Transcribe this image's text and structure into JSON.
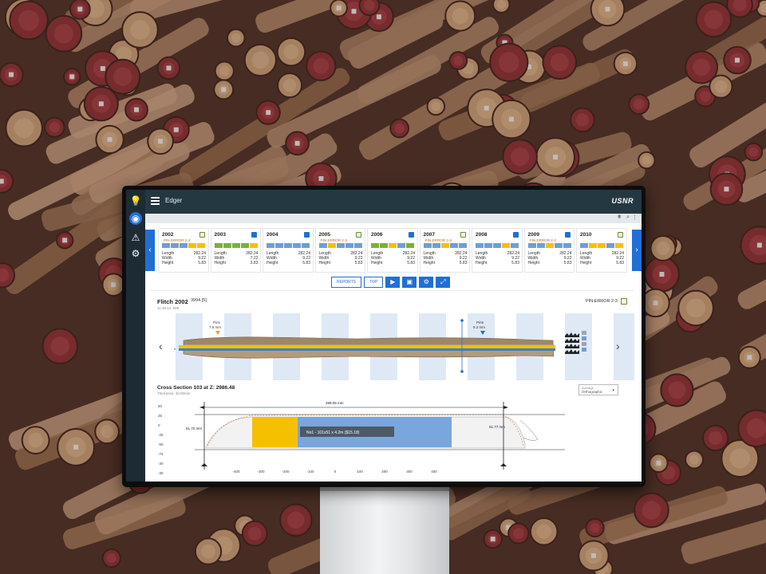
{
  "app": {
    "title": "Edger",
    "brand": "USNR"
  },
  "rail": {
    "items": [
      "lightbulb-icon",
      "gauge-icon",
      "warning-icon",
      "gear-icon"
    ]
  },
  "subbar": {
    "filter_icon": "filter-icon",
    "search_icon": "search-icon",
    "more_icon": "more-vert-icon"
  },
  "colors": {
    "accent": "#1f6fd6",
    "yellow": "#f5c000",
    "green": "#7bb03a",
    "blue": "#6f9ed6",
    "error": "#c06a10"
  },
  "carousel": {
    "prev": "‹",
    "next": "›",
    "cards": [
      {
        "id": "2002",
        "error": "PIN ERROR 2-3",
        "icon": "warn",
        "length": "282.24",
        "width": "9.22",
        "height": "5.83",
        "strip": [
          "blue",
          "blue",
          "blue",
          "yellow",
          "yellow"
        ]
      },
      {
        "id": "2003",
        "error": "",
        "icon": "save",
        "length": "282.24",
        "width": "7.22",
        "height": "3.83",
        "strip": [
          "green",
          "green",
          "green",
          "green",
          "yellow"
        ]
      },
      {
        "id": "2004",
        "error": "",
        "icon": "save",
        "length": "282.24",
        "width": "9.22",
        "height": "5.83",
        "strip": [
          "blue",
          "blue",
          "blue",
          "blue",
          "blue"
        ]
      },
      {
        "id": "2005",
        "error": "PIN ERROR 2-3",
        "icon": "warn",
        "length": "282.24",
        "width": "9.22",
        "height": "5.83",
        "strip": [
          "blue",
          "yellow",
          "blue",
          "blue",
          "blue"
        ]
      },
      {
        "id": "2006",
        "error": "",
        "icon": "save",
        "length": "282.24",
        "width": "9.22",
        "height": "5.83",
        "strip": [
          "green",
          "green",
          "yellow",
          "blue",
          "green"
        ]
      },
      {
        "id": "2007",
        "error": "PIN ERROR 2-3",
        "icon": "warn",
        "length": "282.24",
        "width": "9.22",
        "height": "5.83",
        "strip": [
          "blue",
          "blue",
          "yellow",
          "blue",
          "blue"
        ]
      },
      {
        "id": "2008",
        "error": "",
        "icon": "save",
        "length": "282.24",
        "width": "9.22",
        "height": "5.83",
        "strip": [
          "blue",
          "blue",
          "blue",
          "yellow",
          "blue"
        ]
      },
      {
        "id": "2009",
        "error": "PIN ERROR 2-3",
        "icon": "save",
        "length": "282.24",
        "width": "9.22",
        "height": "5.83",
        "strip": [
          "blue",
          "blue",
          "yellow",
          "blue",
          "blue"
        ]
      },
      {
        "id": "2010",
        "error": "",
        "icon": "warn",
        "length": "282.24",
        "width": "9.22",
        "height": "5.83",
        "strip": [
          "blue",
          "yellow",
          "yellow",
          "blue",
          "yellow"
        ]
      }
    ],
    "labels": {
      "length": "Length",
      "width": "Width",
      "height": "Height"
    }
  },
  "toolbar": {
    "reports": "REPORTS",
    "top": "TOP",
    "play_icon": "play-icon",
    "save_icon": "save-icon",
    "settings_icon": "gear-icon",
    "fullscreen_icon": "fullscreen-icon"
  },
  "flitch": {
    "title": "Flitch 2002",
    "dim": "3994 [5]",
    "timestamp": "11:18:14 .008",
    "pin_error": "PIN ERROR 2-3",
    "pins": [
      {
        "label": "Pin1",
        "value": "7.5 mm"
      },
      {
        "label": "Pin5",
        "value": "8.2 mm"
      }
    ],
    "zero_label": "0"
  },
  "cross_section": {
    "title": "Cross Section 103 at Z: 2986.48",
    "subtitle": "Thickness: 40.00mm",
    "select_label": "Average",
    "select_value": "Orthographic",
    "width_dim": "289.05 mm",
    "left_dim": "51.70 mm",
    "right_dim": "51.77 mm",
    "board_label": "No1 - 101x51 x 4.2m ($15.18)",
    "y_ticks": [
      "50",
      "25",
      "0",
      "-25",
      "-50",
      "-75",
      "-30",
      "-30"
    ],
    "x_ticks": [
      "-400",
      "-300",
      "-200",
      "-100",
      "0",
      "100",
      "200",
      "300",
      "400"
    ]
  }
}
